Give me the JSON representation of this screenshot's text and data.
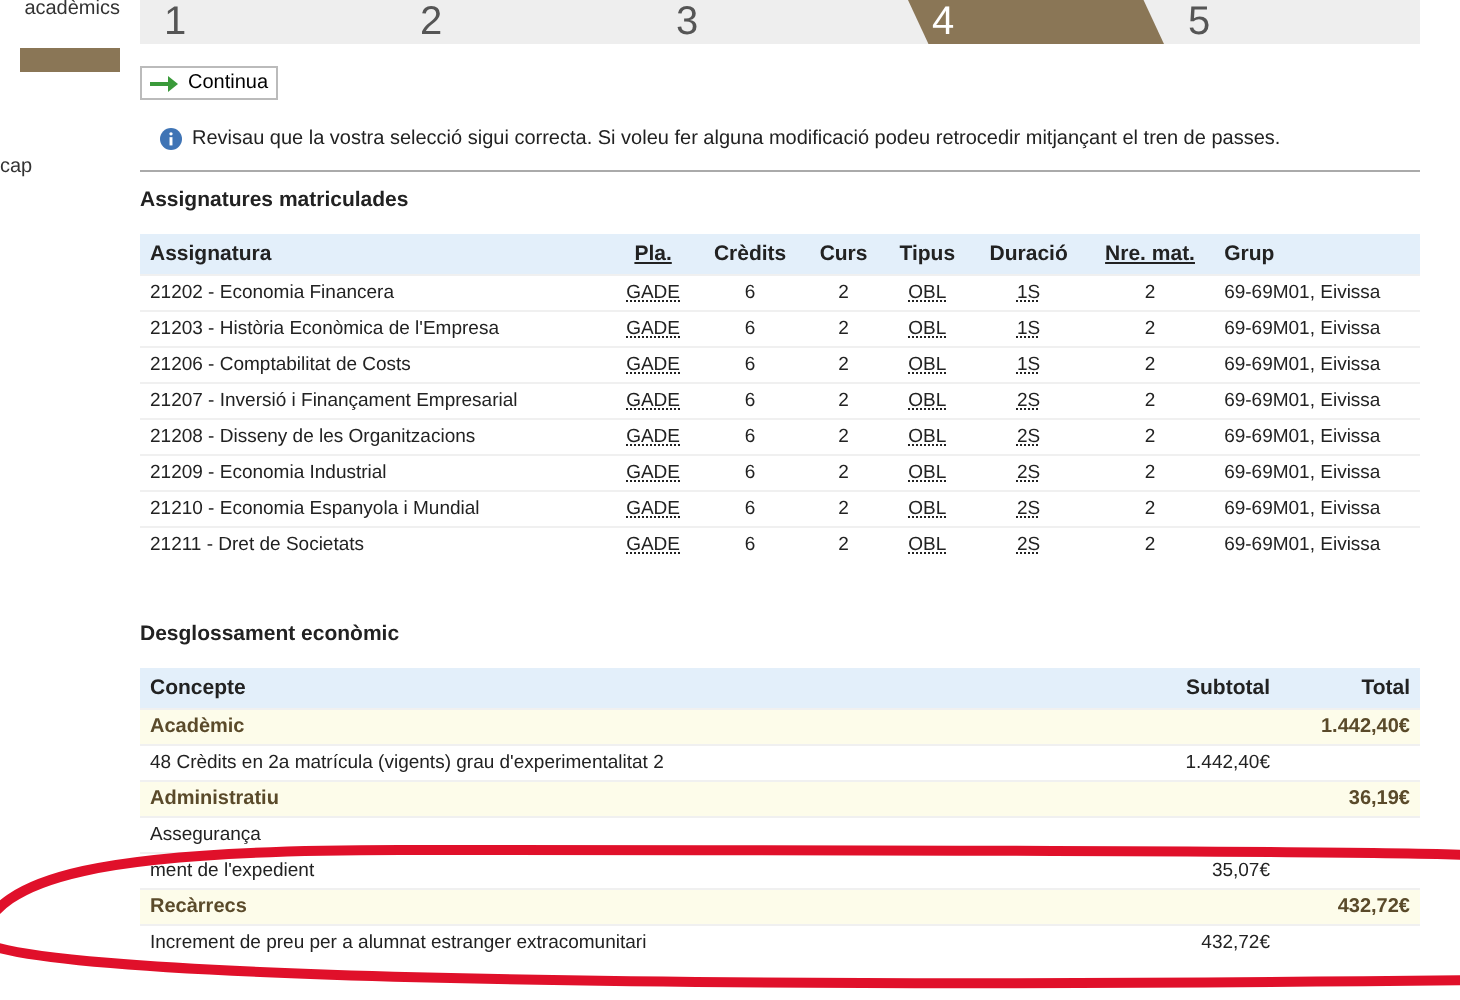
{
  "sidebar": {
    "items": [
      {
        "label": "acadèmics",
        "selected": false
      },
      {
        "selected": true
      },
      {
        "label": "cap",
        "selected": false
      }
    ]
  },
  "steps": [
    {
      "number": "1",
      "selected": false
    },
    {
      "number": "2",
      "selected": false
    },
    {
      "number": "3",
      "selected": false
    },
    {
      "number": "4",
      "selected": true
    },
    {
      "number": "5",
      "selected": false
    }
  ],
  "continue_button": "Continua",
  "info": "Revisau que la vostra selecció sigui correcta. Si voleu fer alguna modificació podeu retrocedir mitjançant el tren de passes.",
  "subjects": {
    "title": "Assignatures matriculades",
    "columns": [
      "Assignatura",
      "Pla.",
      "Crèdits",
      "Curs",
      "Tipus",
      "Duració",
      "Nre. mat.",
      "Grup"
    ],
    "rows": [
      [
        "21202 - Economia Financera",
        "GADE",
        "6",
        "2",
        "OBL",
        "1S",
        "2",
        "69-69M01, Eivissa"
      ],
      [
        "21203 - Història Econòmica de l'Empresa",
        "GADE",
        "6",
        "2",
        "OBL",
        "1S",
        "2",
        "69-69M01, Eivissa"
      ],
      [
        "21206 - Comptabilitat de Costs",
        "GADE",
        "6",
        "2",
        "OBL",
        "1S",
        "2",
        "69-69M01, Eivissa"
      ],
      [
        "21207 - Inversió i Finançament Empresarial",
        "GADE",
        "6",
        "2",
        "OBL",
        "2S",
        "2",
        "69-69M01, Eivissa"
      ],
      [
        "21208 - Disseny de les Organitzacions",
        "GADE",
        "6",
        "2",
        "OBL",
        "2S",
        "2",
        "69-69M01, Eivissa"
      ],
      [
        "21209 - Economia Industrial",
        "GADE",
        "6",
        "2",
        "OBL",
        "2S",
        "2",
        "69-69M01, Eivissa"
      ],
      [
        "21210 - Economia Espanyola i Mundial",
        "GADE",
        "6",
        "2",
        "OBL",
        "2S",
        "2",
        "69-69M01, Eivissa"
      ],
      [
        "21211 - Dret de Societats",
        "GADE",
        "6",
        "2",
        "OBL",
        "2S",
        "2",
        "69-69M01, Eivissa"
      ]
    ]
  },
  "breakdown": {
    "title": "Desglossament econòmic",
    "columns": [
      "Concepte",
      "Subtotal",
      "Total"
    ],
    "rows": [
      {
        "kind": "category",
        "concept": "Acadèmic",
        "total": "1.442,40€"
      },
      {
        "kind": "item",
        "concept": "48 Crèdits en 2a matrícula (vigents) grau d'experimentalitat 2",
        "subtotal": "1.442,40€"
      },
      {
        "kind": "category",
        "concept": "Administratiu",
        "total": "36,19€"
      },
      {
        "kind": "item",
        "concept": "Assegurança"
      },
      {
        "kind": "item",
        "concept": "ment de l'expedient",
        "subtotal": "35,07€"
      },
      {
        "kind": "category",
        "concept": "Recàrrecs",
        "total": "432,72€"
      },
      {
        "kind": "item",
        "concept": "Increment de preu per a alumnat estranger extracomunitari",
        "subtotal": "432,72€"
      }
    ]
  }
}
